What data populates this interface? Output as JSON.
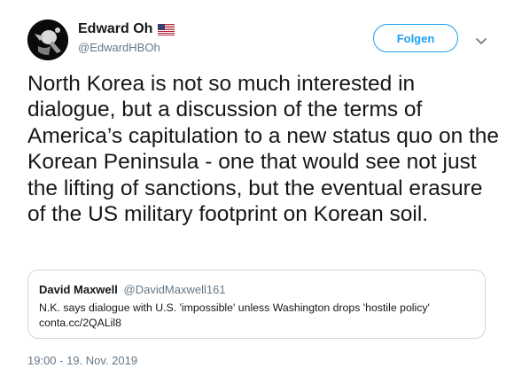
{
  "author": {
    "display_name": "Edward Oh",
    "handle": "@EdwardHBOh",
    "avatar_icon": "user-avatar-icon",
    "flag_icon": "us-flag-icon"
  },
  "follow_button": {
    "label": "Folgen"
  },
  "menu_icon": "chevron-down-icon",
  "tweet_text": "North Korea is not so much interested in dialogue, but a discussion of the terms of America’s capitulation to a new status quo on the Korean Peninsula - one that would see not just the lifting of sanctions, but the eventual erasure of the US military footprint on Korean soil.",
  "quoted_tweet": {
    "display_name": "David Maxwell",
    "handle": "@DavidMaxwell161",
    "text": "N.K. says dialogue with U.S. 'impossible' unless Washington drops 'hostile policy'",
    "link": "conta.cc/2QALil8"
  },
  "timestamp": "19:00 - 19. Nov. 2019",
  "colors": {
    "accent": "#1da1f2",
    "text_primary": "#14171a",
    "text_secondary": "#657786",
    "border": "#ccd6dd"
  }
}
